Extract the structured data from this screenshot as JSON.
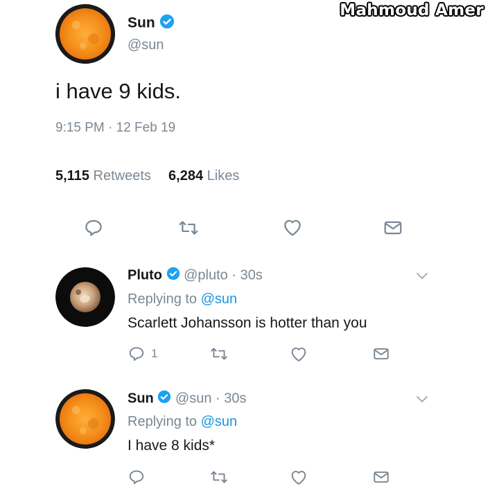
{
  "watermark": "Mahmoud Amer",
  "main_tweet": {
    "author_name": "Sun",
    "handle": "@sun",
    "text": "i have 9 kids.",
    "timestamp": "9:15 PM · 12 Feb 19",
    "retweets_count": "5,115",
    "retweets_label": "Retweets",
    "likes_count": "6,284",
    "likes_label": "Likes",
    "avatar_icon": "sun-avatar",
    "verified_color": "#1da1f2"
  },
  "replies": [
    {
      "author_name": "Pluto",
      "handle": "@pluto",
      "time": "· 30s",
      "replying_label": "Replying to",
      "replying_handle": "@sun",
      "text": "Scarlett Johansson is hotter than you",
      "reply_count": "1",
      "avatar_icon": "pluto-avatar"
    },
    {
      "author_name": "Sun",
      "handle": "@sun",
      "time": "· 30s",
      "replying_label": "Replying to",
      "replying_handle": "@sun",
      "text": "I have 8 kids*",
      "reply_count": "",
      "avatar_icon": "sun-avatar"
    }
  ],
  "colors": {
    "text": "#14171a",
    "muted": "#7a8793",
    "link": "#1b95e0",
    "verified": "#1da1f2"
  }
}
